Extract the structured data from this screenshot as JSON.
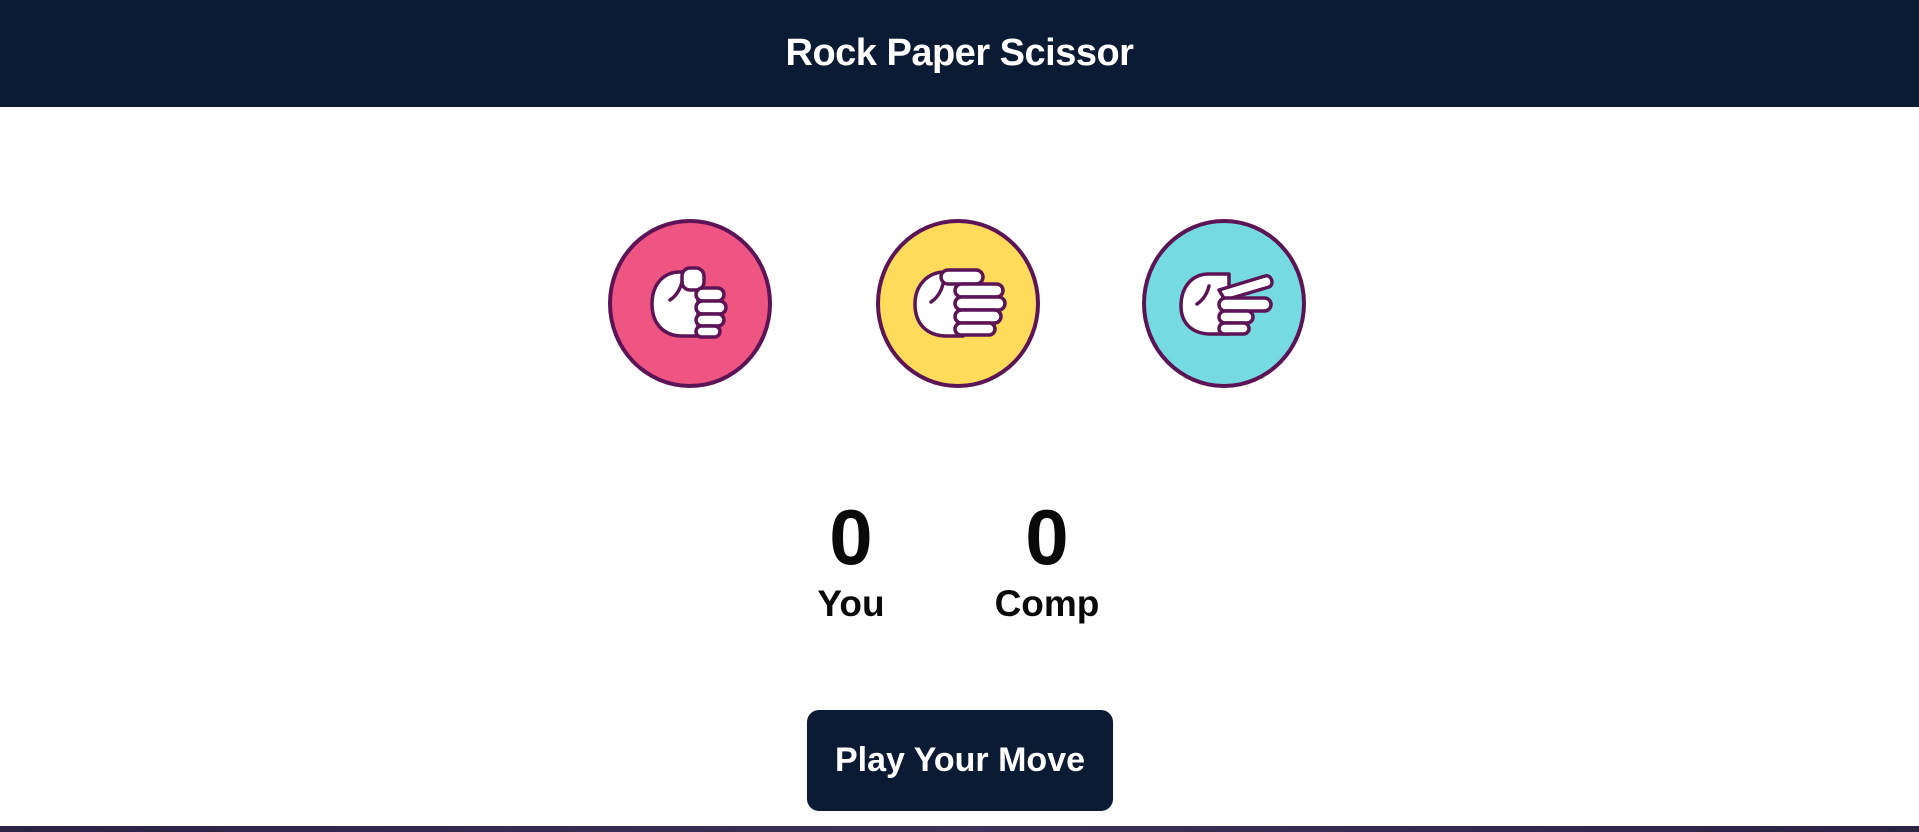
{
  "header": {
    "title": "Rock Paper Scissor"
  },
  "choices": [
    {
      "id": "rock",
      "icon": "rock-hand-icon",
      "color": "#ef5583"
    },
    {
      "id": "paper",
      "icon": "paper-hand-icon",
      "color": "#fedb5a"
    },
    {
      "id": "scissor",
      "icon": "scissor-hand-icon",
      "color": "#76dbe1"
    }
  ],
  "score": {
    "user_value": "0",
    "user_label": "You",
    "comp_value": "0",
    "comp_label": "Comp"
  },
  "action": {
    "play_label": "Play Your Move"
  },
  "colors": {
    "header_bg": "#0b1b33",
    "outline": "#5c1456",
    "button_bg": "#0b1b33"
  }
}
